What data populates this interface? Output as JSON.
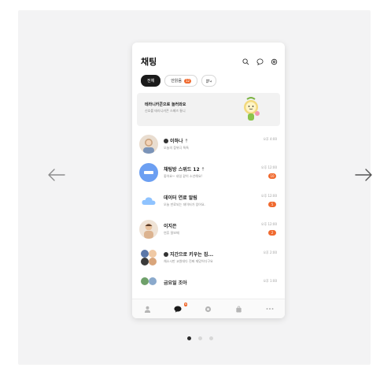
{
  "header": {
    "title": "채팅"
  },
  "tabs": [
    {
      "label": "전체",
      "badge": ""
    },
    {
      "label": "안읽음",
      "badge": "12"
    }
  ],
  "banner": {
    "title": "테라니카콘으로 놀러와요",
    "subtitle": "신호를 테라니카콘 스페즈 통니"
  },
  "rows": [
    {
      "name": "이하나",
      "message": "오늘의 참위극 특특",
      "time": "오후 4:00",
      "badge": ""
    },
    {
      "name": "채팅방 스위드 12",
      "message": "좋아요~ 내일 같이 소년해요!",
      "time": "오후 12:00",
      "badge": "10"
    },
    {
      "name": "데이터 연료 알림",
      "message": "오늘 만료되는 데이터가 있어요.",
      "time": "오후 12:00",
      "badge": "5"
    },
    {
      "name": "이지은",
      "message": "연휴 잘보때",
      "time": "오후 12:00",
      "badge": "2"
    },
    {
      "name": "지간으로 키우는 집...",
      "message": "채소시만 교원데다 진짜 재밌어다구요",
      "time": "오후 2:00",
      "badge": ""
    },
    {
      "name": "금요일 조아",
      "message": "",
      "time": "오후 1:00",
      "badge": ""
    }
  ],
  "bottom_nav": {
    "chat_badge": "N"
  },
  "colors": {
    "accent": "#f06a2f",
    "stage": "#f3f3f4",
    "banner": "#f2f2f2"
  }
}
